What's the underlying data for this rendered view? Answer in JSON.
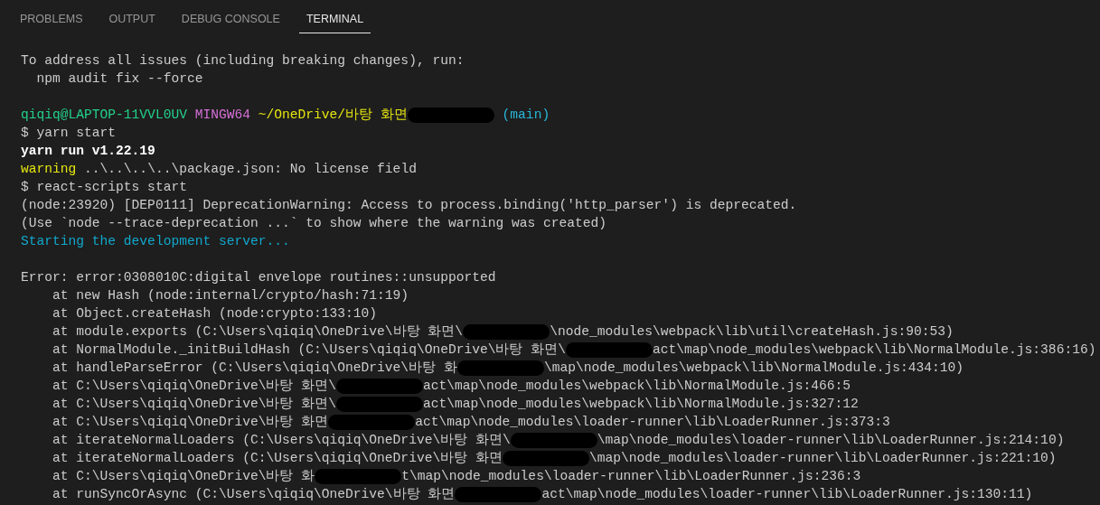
{
  "tabs": [
    {
      "label": "PROBLEMS",
      "selected": false
    },
    {
      "label": "OUTPUT",
      "selected": false
    },
    {
      "label": "DEBUG CONSOLE",
      "selected": false
    },
    {
      "label": "TERMINAL",
      "selected": true
    }
  ],
  "terminal": {
    "lines": [
      {
        "segments": [
          {
            "kind": "plain",
            "text": "To address all issues (including breaking changes), run:"
          }
        ]
      },
      {
        "segments": [
          {
            "kind": "plain",
            "text": "  npm audit fix --force"
          }
        ]
      },
      {
        "kind": "blank"
      },
      {
        "segments": [
          {
            "kind": "user",
            "text": "qiqiq@LAPTOP-11VVL0UV"
          },
          {
            "kind": "shell",
            "text": " MINGW64"
          },
          {
            "kind": "path",
            "text": " ~/OneDrive/바탕 화면"
          },
          {
            "kind": "redaction"
          },
          {
            "kind": "branch",
            "text": " (main)"
          }
        ]
      },
      {
        "segments": [
          {
            "kind": "plain",
            "text": "$ yarn start"
          }
        ]
      },
      {
        "segments": [
          {
            "kind": "bold",
            "text": "yarn run v1.22.19"
          }
        ]
      },
      {
        "segments": [
          {
            "kind": "warning",
            "text": "warning"
          },
          {
            "kind": "plain",
            "text": " ..\\..\\..\\..\\package.json: No license field"
          }
        ]
      },
      {
        "segments": [
          {
            "kind": "plain",
            "text": "$ react-scripts start"
          }
        ]
      },
      {
        "segments": [
          {
            "kind": "plain",
            "text": "(node:23920) [DEP0111] DeprecationWarning: Access to process.binding('http_parser') is deprecated."
          }
        ]
      },
      {
        "segments": [
          {
            "kind": "plain",
            "text": "(Use `node --trace-deprecation ...` to show where the warning was created)"
          }
        ]
      },
      {
        "segments": [
          {
            "kind": "info",
            "text": "Starting the development server..."
          }
        ]
      },
      {
        "kind": "blank"
      },
      {
        "segments": [
          {
            "kind": "plain",
            "text": "Error: error:0308010C:digital envelope routines::unsupported"
          }
        ]
      },
      {
        "segments": [
          {
            "kind": "plain",
            "text": "    at new Hash (node:internal/crypto/hash:71:19)"
          }
        ]
      },
      {
        "segments": [
          {
            "kind": "plain",
            "text": "    at Object.createHash (node:crypto:133:10)"
          }
        ]
      },
      {
        "segments": [
          {
            "kind": "plain",
            "text": "    at module.exports (C:\\Users\\qiqiq\\OneDrive\\바탕 화면\\"
          },
          {
            "kind": "redaction"
          },
          {
            "kind": "plain",
            "text": "\\node_modules\\webpack\\lib\\util\\createHash.js:90:53)"
          }
        ]
      },
      {
        "segments": [
          {
            "kind": "plain",
            "text": "    at NormalModule._initBuildHash (C:\\Users\\qiqiq\\OneDrive\\바탕 화면\\"
          },
          {
            "kind": "redaction"
          },
          {
            "kind": "plain",
            "text": "act\\map\\node_modules\\webpack\\lib\\NormalModule.js:386:16)"
          }
        ]
      },
      {
        "segments": [
          {
            "kind": "plain",
            "text": "    at handleParseError (C:\\Users\\qiqiq\\OneDrive\\바탕 화"
          },
          {
            "kind": "redaction"
          },
          {
            "kind": "plain",
            "text": "\\map\\node_modules\\webpack\\lib\\NormalModule.js:434:10)"
          }
        ]
      },
      {
        "segments": [
          {
            "kind": "plain",
            "text": "    at C:\\Users\\qiqiq\\OneDrive\\바탕 화면\\"
          },
          {
            "kind": "redaction"
          },
          {
            "kind": "plain",
            "text": "act\\map\\node_modules\\webpack\\lib\\NormalModule.js:466:5"
          }
        ]
      },
      {
        "segments": [
          {
            "kind": "plain",
            "text": "    at C:\\Users\\qiqiq\\OneDrive\\바탕 화면\\"
          },
          {
            "kind": "redaction"
          },
          {
            "kind": "plain",
            "text": "act\\map\\node_modules\\webpack\\lib\\NormalModule.js:327:12"
          }
        ]
      },
      {
        "segments": [
          {
            "kind": "plain",
            "text": "    at C:\\Users\\qiqiq\\OneDrive\\바탕 화면"
          },
          {
            "kind": "redaction"
          },
          {
            "kind": "plain",
            "text": "act\\map\\node_modules\\loader-runner\\lib\\LoaderRunner.js:373:3"
          }
        ]
      },
      {
        "segments": [
          {
            "kind": "plain",
            "text": "    at iterateNormalLoaders (C:\\Users\\qiqiq\\OneDrive\\바탕 화면\\"
          },
          {
            "kind": "redaction"
          },
          {
            "kind": "plain",
            "text": "\\map\\node_modules\\loader-runner\\lib\\LoaderRunner.js:214:10)"
          }
        ]
      },
      {
        "segments": [
          {
            "kind": "plain",
            "text": "    at iterateNormalLoaders (C:\\Users\\qiqiq\\OneDrive\\바탕 화면"
          },
          {
            "kind": "redaction"
          },
          {
            "kind": "plain",
            "text": "\\map\\node_modules\\loader-runner\\lib\\LoaderRunner.js:221:10)"
          }
        ]
      },
      {
        "segments": [
          {
            "kind": "plain",
            "text": "    at C:\\Users\\qiqiq\\OneDrive\\바탕 화"
          },
          {
            "kind": "redaction"
          },
          {
            "kind": "plain",
            "text": "t\\map\\node_modules\\loader-runner\\lib\\LoaderRunner.js:236:3"
          }
        ]
      },
      {
        "segments": [
          {
            "kind": "plain",
            "text": "    at runSyncOrAsync (C:\\Users\\qiqiq\\OneDrive\\바탕 화면"
          },
          {
            "kind": "redaction"
          },
          {
            "kind": "plain",
            "text": "act\\map\\node_modules\\loader-runner\\lib\\LoaderRunner.js:130:11)"
          }
        ]
      }
    ]
  }
}
